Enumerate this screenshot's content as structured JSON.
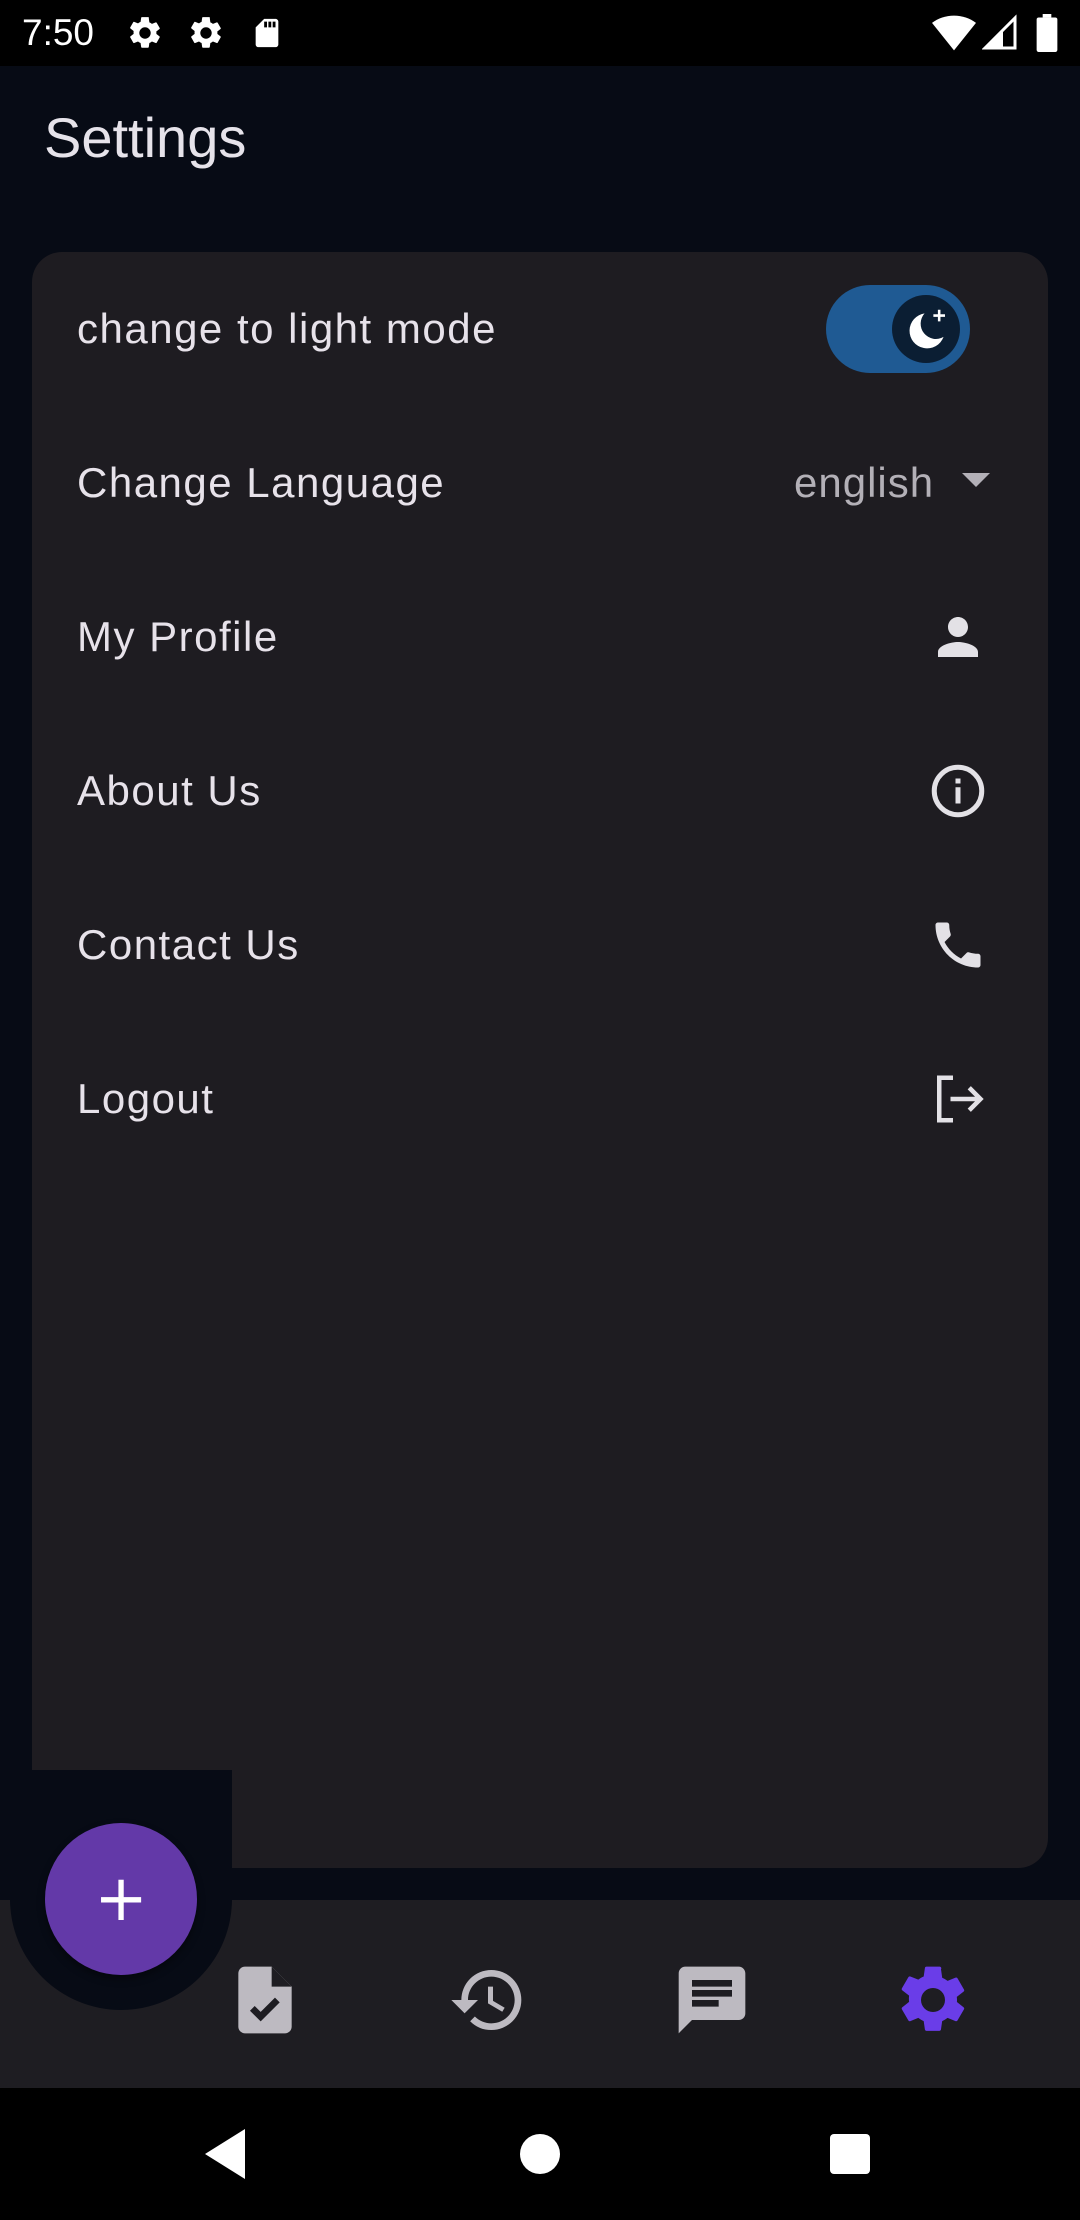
{
  "status_bar": {
    "time": "7:50",
    "left_icons": [
      "settings-icon",
      "settings-icon",
      "sd-card-icon"
    ],
    "right_icons": [
      "wifi-icon",
      "signal-icon",
      "battery-icon"
    ]
  },
  "app_bar": {
    "title": "Settings"
  },
  "settings": {
    "theme_toggle": {
      "label": "change to light mode",
      "on": true,
      "thumb_icon": "moon-icon",
      "track_color": "#1f5a93"
    },
    "language": {
      "label": "Change Language",
      "selected": "english"
    },
    "items": [
      {
        "label": "My Profile",
        "icon": "person-icon"
      },
      {
        "label": "About Us",
        "icon": "info-icon"
      },
      {
        "label": "Contact Us",
        "icon": "phone-icon"
      },
      {
        "label": "Logout",
        "icon": "logout-icon"
      }
    ]
  },
  "fab": {
    "label": "+",
    "color": "#6339a8"
  },
  "bottom_nav": {
    "items": [
      {
        "icon": "task-file-icon",
        "active": false
      },
      {
        "icon": "history-icon",
        "active": false
      },
      {
        "icon": "chat-icon",
        "active": false
      },
      {
        "icon": "settings-icon",
        "active": true
      }
    ],
    "active_color": "#6a3de8",
    "inactive_color": "#bdbac1"
  },
  "system_nav": {
    "buttons": [
      "back-icon",
      "home-icon",
      "recents-icon"
    ]
  }
}
